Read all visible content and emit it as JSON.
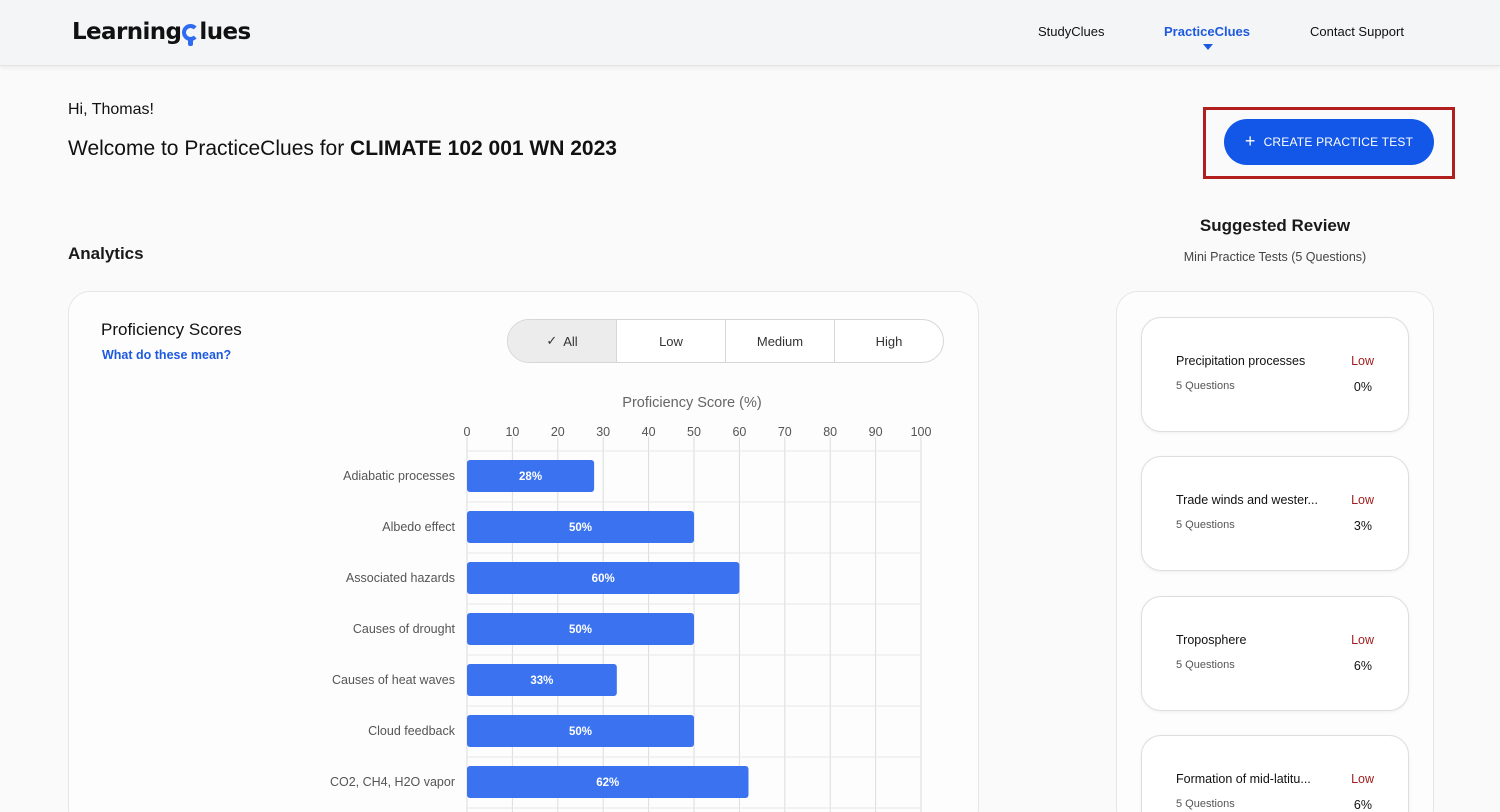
{
  "header": {
    "logo_text_start": "Learning",
    "logo_text_end": "lues",
    "nav": [
      {
        "label": "StudyClues",
        "active": false
      },
      {
        "label": "PracticeClues",
        "active": true
      },
      {
        "label": "Contact Support",
        "active": false
      }
    ]
  },
  "intro": {
    "greeting": "Hi, Thomas!",
    "welcome_prefix": "Welcome to PracticeClues for ",
    "course": "CLIMATE 102 001 WN 2023"
  },
  "create_button": {
    "icon": "plus-icon",
    "label": "CREATE PRACTICE TEST"
  },
  "analytics": {
    "title": "Analytics",
    "card_title": "Proficiency Scores",
    "help_link": "What do these mean?",
    "filters": [
      {
        "label": "All",
        "selected": true
      },
      {
        "label": "Low",
        "selected": false
      },
      {
        "label": "Medium",
        "selected": false
      },
      {
        "label": "High",
        "selected": false
      }
    ]
  },
  "chart_data": {
    "type": "bar",
    "orientation": "horizontal",
    "title": "Proficiency Score (%)",
    "xlim": [
      0,
      100
    ],
    "xticks": [
      0,
      10,
      20,
      30,
      40,
      50,
      60,
      70,
      80,
      90,
      100
    ],
    "grid": true,
    "bar_color": "#3b72f0",
    "categories": [
      "Adiabatic processes",
      "Albedo effect",
      "Associated hazards",
      "Causes of drought",
      "Causes of heat waves",
      "Cloud feedback",
      "CO2, CH4, H2O vapor"
    ],
    "values": [
      28,
      50,
      60,
      50,
      33,
      50,
      62
    ],
    "data_labels": [
      "28%",
      "50%",
      "60%",
      "50%",
      "33%",
      "50%",
      "62%"
    ]
  },
  "review": {
    "title": "Suggested Review",
    "subtitle": "Mini Practice Tests (5 Questions)",
    "items": [
      {
        "topic": "Precipitation processes",
        "level": "Low",
        "questions": "5 Questions",
        "score": "0%"
      },
      {
        "topic": "Trade winds and wester...",
        "level": "Low",
        "questions": "5 Questions",
        "score": "3%"
      },
      {
        "topic": "Troposphere",
        "level": "Low",
        "questions": "5 Questions",
        "score": "6%"
      },
      {
        "topic": "Formation of mid-latitu...",
        "level": "Low",
        "questions": "5 Questions",
        "score": "6%"
      }
    ]
  }
}
